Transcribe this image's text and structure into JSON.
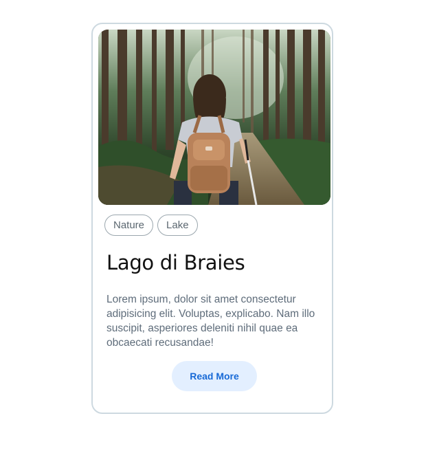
{
  "card": {
    "image_alt": "Hiker with backpack walking on a forest trail",
    "tags": [
      "Nature",
      "Lake"
    ],
    "title": "Lago di Braies",
    "description": "Lorem ipsum, dolor sit amet consectetur adipisicing elit. Voluptas, explicabo. Nam illo suscipit, asperiores deleniti nihil quae ea obcaecati recusandae!",
    "button_label": "Read More"
  },
  "colors": {
    "card_border": "#cdd9e0",
    "tag_border": "#9aa6ad",
    "title": "#111111",
    "description": "#5e6c7a",
    "button_bg": "#e3efff",
    "button_text": "#1769d6"
  }
}
